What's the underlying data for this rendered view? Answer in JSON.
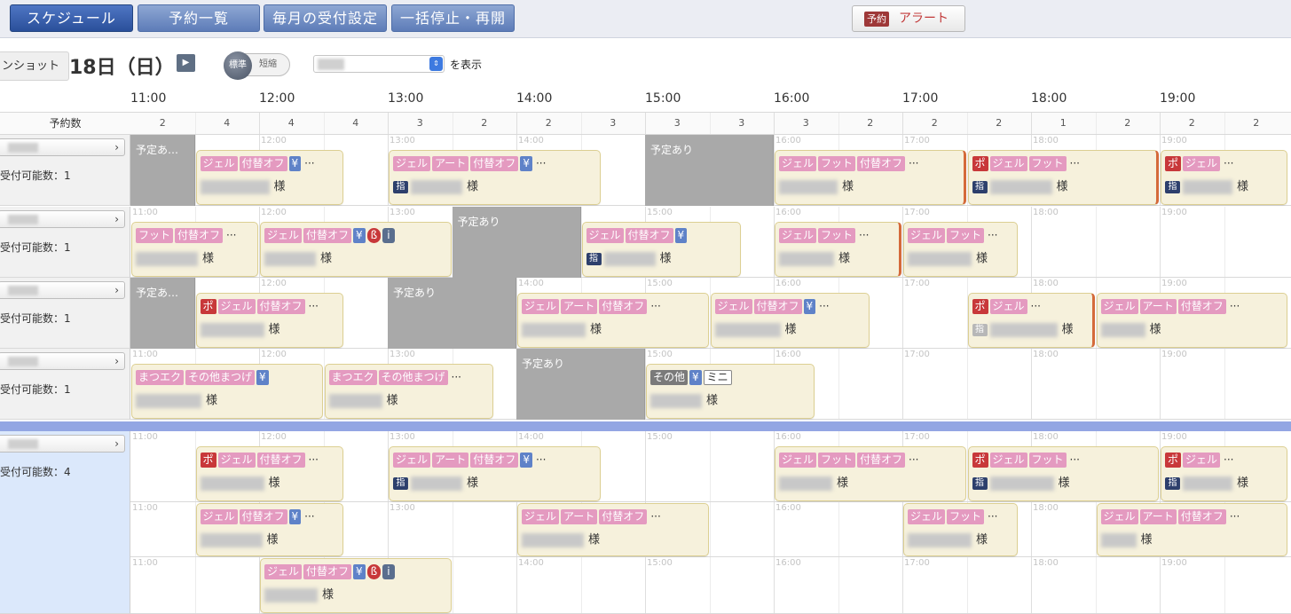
{
  "nav": [
    {
      "label": "スケジュール",
      "active": true
    },
    {
      "label": "予約一覧"
    },
    {
      "label": "毎月の受付設定"
    },
    {
      "label": "一括停止・再開"
    }
  ],
  "alert": {
    "tag": "予約",
    "label": "アラート"
  },
  "toolbar": {
    "screenshot_label": "ンショット",
    "date": "18日（日）",
    "toggle_standard": "標準",
    "toggle_short": "短縮",
    "display_suffix": "を表示"
  },
  "hours": [
    "11:00",
    "12:00",
    "13:00",
    "14:00",
    "15:00",
    "16:00",
    "17:00",
    "18:00",
    "19:00"
  ],
  "counts_label": "予約数",
  "counts": [
    "2",
    "4",
    "4",
    "4",
    "3",
    "2",
    "2",
    "3",
    "3",
    "3",
    "3",
    "2",
    "2",
    "2",
    "1",
    "2",
    "2",
    "2"
  ],
  "sama": "様",
  "block_labels": {
    "short": "予定あ…",
    "full": "予定あり"
  },
  "staff": [
    {
      "capacity": "受付可能数：1",
      "lanes": [
        {
          "blocks": [
            {
              "start": 0,
              "span": 1,
              "label": "short"
            },
            {
              "start": 8,
              "span": 2,
              "label": "full"
            }
          ],
          "appts": [
            {
              "start": 1,
              "span": 2.32,
              "tags": [
                [
                  "pink",
                  "ジェル"
                ],
                [
                  "pink",
                  "付替オフ"
                ],
                [
                  "blue",
                  "¥"
                ],
                [
                  "more",
                  "···"
                ]
              ],
              "shi": false,
              "w": 78
            },
            {
              "start": 4,
              "span": 3.33,
              "tags": [
                [
                  "pink",
                  "ジェル"
                ],
                [
                  "pink",
                  "アート"
                ],
                [
                  "pink",
                  "付替オフ"
                ],
                [
                  "blue",
                  "¥"
                ],
                [
                  "more",
                  "···"
                ]
              ],
              "shi": true,
              "w": 58
            },
            {
              "start": 10,
              "span": 3.0,
              "bar": true,
              "tags": [
                [
                  "pink",
                  "ジェル"
                ],
                [
                  "pink",
                  "フット"
                ],
                [
                  "pink",
                  "付替オフ"
                ],
                [
                  "more",
                  "···"
                ]
              ],
              "shi": false,
              "w": 66
            },
            {
              "start": 13,
              "span": 3.0,
              "bar": true,
              "tags": [
                [
                  "red",
                  "ポ"
                ],
                [
                  "pink",
                  "ジェル"
                ],
                [
                  "pink",
                  "フット"
                ],
                [
                  "more",
                  "···"
                ]
              ],
              "shi": true,
              "w": 70
            },
            {
              "start": 16,
              "span": 2.0,
              "tags": [
                [
                  "red",
                  "ポ"
                ],
                [
                  "pink",
                  "ジェル"
                ],
                [
                  "more",
                  "···"
                ]
              ],
              "shi": true,
              "w": 56
            }
          ]
        }
      ]
    },
    {
      "capacity": "受付可能数：1",
      "lanes": [
        {
          "blocks": [
            {
              "start": 5,
              "span": 2,
              "label": "full"
            }
          ],
          "appts": [
            {
              "start": 0,
              "span": 2.0,
              "tags": [
                [
                  "pink",
                  "フット"
                ],
                [
                  "pink",
                  "付替オフ"
                ],
                [
                  "more",
                  "···"
                ]
              ],
              "shi": false,
              "w": 70
            },
            {
              "start": 2,
              "span": 3.0,
              "tags": [
                [
                  "pink",
                  "ジェル"
                ],
                [
                  "pink",
                  "付替オフ"
                ],
                [
                  "blue",
                  "¥"
                ],
                [
                  "dark-r",
                  "ß"
                ],
                [
                  "info",
                  "i"
                ]
              ],
              "shi": false,
              "w": 58
            },
            {
              "start": 7,
              "span": 2.5,
              "tags": [
                [
                  "pink",
                  "ジェル"
                ],
                [
                  "pink",
                  "付替オフ"
                ],
                [
                  "blue",
                  "¥"
                ]
              ],
              "shi": true,
              "w": 58
            },
            {
              "start": 10,
              "span": 2.0,
              "bar": true,
              "tags": [
                [
                  "pink",
                  "ジェル"
                ],
                [
                  "pink",
                  "フット"
                ],
                [
                  "more",
                  "···"
                ]
              ],
              "shi": false,
              "w": 62
            },
            {
              "start": 12,
              "span": 1.8,
              "tags": [
                [
                  "pink",
                  "ジェル"
                ],
                [
                  "pink",
                  "フット"
                ],
                [
                  "more",
                  "···"
                ]
              ],
              "shi": false,
              "w": 72
            }
          ]
        }
      ]
    },
    {
      "capacity": "受付可能数：1",
      "lanes": [
        {
          "blocks": [
            {
              "start": 0,
              "span": 1,
              "label": "short"
            },
            {
              "start": 4,
              "span": 2,
              "label": "full"
            }
          ],
          "appts": [
            {
              "start": 1,
              "span": 2.32,
              "tags": [
                [
                  "red",
                  "ポ"
                ],
                [
                  "pink",
                  "ジェル"
                ],
                [
                  "pink",
                  "付替オフ"
                ],
                [
                  "more",
                  "···"
                ]
              ],
              "shi": false,
              "w": 72
            },
            {
              "start": 6,
              "span": 3.0,
              "tags": [
                [
                  "pink",
                  "ジェル"
                ],
                [
                  "pink",
                  "アート"
                ],
                [
                  "pink",
                  "付替オフ"
                ],
                [
                  "more",
                  "···"
                ]
              ],
              "shi": false,
              "w": 72
            },
            {
              "start": 9,
              "span": 2.5,
              "tags": [
                [
                  "pink",
                  "ジェル"
                ],
                [
                  "pink",
                  "付替オフ"
                ],
                [
                  "blue",
                  "¥"
                ],
                [
                  "more",
                  "···"
                ]
              ],
              "shi": false,
              "w": 74
            },
            {
              "start": 13,
              "span": 2.0,
              "bar": true,
              "tags": [
                [
                  "red",
                  "ポ"
                ],
                [
                  "pink",
                  "ジェル"
                ],
                [
                  "more",
                  "···"
                ]
              ],
              "shi": true,
              "shiLight": true,
              "w": 76
            },
            {
              "start": 15,
              "span": 3.0,
              "tags": [
                [
                  "pink",
                  "ジェル"
                ],
                [
                  "pink",
                  "アート"
                ],
                [
                  "pink",
                  "付替オフ"
                ],
                [
                  "more",
                  "···"
                ]
              ],
              "shi": false,
              "w": 50
            }
          ]
        }
      ]
    },
    {
      "capacity": "受付可能数：1",
      "lanes": [
        {
          "blocks": [
            {
              "start": 6,
              "span": 2,
              "label": "full"
            }
          ],
          "appts": [
            {
              "start": 0,
              "span": 3.0,
              "tags": [
                [
                  "pink",
                  "まつエク"
                ],
                [
                  "pink",
                  "その他まつげ"
                ],
                [
                  "blue",
                  "¥"
                ]
              ],
              "shi": false,
              "w": 74
            },
            {
              "start": 3,
              "span": 2.65,
              "tags": [
                [
                  "pink",
                  "まつエク"
                ],
                [
                  "pink",
                  "その他まつげ"
                ],
                [
                  "more",
                  "···"
                ]
              ],
              "shi": false,
              "w": 60
            },
            {
              "start": 8,
              "span": 2.65,
              "tags": [
                [
                  "gray",
                  "その他"
                ],
                [
                  "blue",
                  "¥"
                ],
                [
                  "outline",
                  "ミニ"
                ]
              ],
              "shi": false,
              "w": 58
            }
          ]
        }
      ]
    },
    {
      "capacity": "受付可能数：4",
      "lanes": [
        {
          "blocks": [],
          "appts": [
            {
              "start": 1,
              "span": 2.32,
              "tags": [
                [
                  "red",
                  "ポ"
                ],
                [
                  "pink",
                  "ジェル"
                ],
                [
                  "pink",
                  "付替オフ"
                ],
                [
                  "more",
                  "···"
                ]
              ],
              "shi": false,
              "w": 72
            },
            {
              "start": 4,
              "span": 3.33,
              "tags": [
                [
                  "pink",
                  "ジェル"
                ],
                [
                  "pink",
                  "アート"
                ],
                [
                  "pink",
                  "付替オフ"
                ],
                [
                  "blue",
                  "¥"
                ],
                [
                  "more",
                  "···"
                ]
              ],
              "shi": true,
              "w": 58
            },
            {
              "start": 10,
              "span": 3.0,
              "tags": [
                [
                  "pink",
                  "ジェル"
                ],
                [
                  "pink",
                  "フット"
                ],
                [
                  "pink",
                  "付替オフ"
                ],
                [
                  "more",
                  "···"
                ]
              ],
              "shi": false,
              "w": 60
            },
            {
              "start": 13,
              "span": 3.0,
              "tags": [
                [
                  "red",
                  "ポ"
                ],
                [
                  "pink",
                  "ジェル"
                ],
                [
                  "pink",
                  "フット"
                ],
                [
                  "more",
                  "···"
                ]
              ],
              "shi": true,
              "w": 72
            },
            {
              "start": 16,
              "span": 2.0,
              "tags": [
                [
                  "red",
                  "ポ"
                ],
                [
                  "pink",
                  "ジェル"
                ],
                [
                  "more",
                  "···"
                ]
              ],
              "shi": true,
              "w": 56
            }
          ]
        },
        {
          "blocks": [],
          "appts": [
            {
              "start": 1,
              "span": 2.32,
              "tags": [
                [
                  "pink",
                  "ジェル"
                ],
                [
                  "pink",
                  "付替オフ"
                ],
                [
                  "blue",
                  "¥"
                ],
                [
                  "more",
                  "···"
                ]
              ],
              "shi": false,
              "w": 70
            },
            {
              "start": 6,
              "span": 3.0,
              "tags": [
                [
                  "pink",
                  "ジェル"
                ],
                [
                  "pink",
                  "アート"
                ],
                [
                  "pink",
                  "付替オフ"
                ],
                [
                  "more",
                  "···"
                ]
              ],
              "shi": false,
              "w": 70
            },
            {
              "start": 12,
              "span": 1.8,
              "tags": [
                [
                  "pink",
                  "ジェル"
                ],
                [
                  "pink",
                  "フット"
                ],
                [
                  "more",
                  "···"
                ]
              ],
              "shi": false,
              "w": 72
            },
            {
              "start": 15,
              "span": 3.0,
              "tags": [
                [
                  "pink",
                  "ジェル"
                ],
                [
                  "pink",
                  "アート"
                ],
                [
                  "pink",
                  "付替オフ"
                ],
                [
                  "more",
                  "···"
                ]
              ],
              "shi": false,
              "w": 40
            }
          ]
        },
        {
          "blocks": [],
          "appts": [
            {
              "start": 2,
              "span": 3.0,
              "tags": [
                [
                  "pink",
                  "ジェル"
                ],
                [
                  "pink",
                  "付替オフ"
                ],
                [
                  "blue",
                  "¥"
                ],
                [
                  "dark-r",
                  "ß"
                ],
                [
                  "info",
                  "i"
                ]
              ],
              "shi": false,
              "w": 60
            }
          ]
        }
      ]
    }
  ]
}
